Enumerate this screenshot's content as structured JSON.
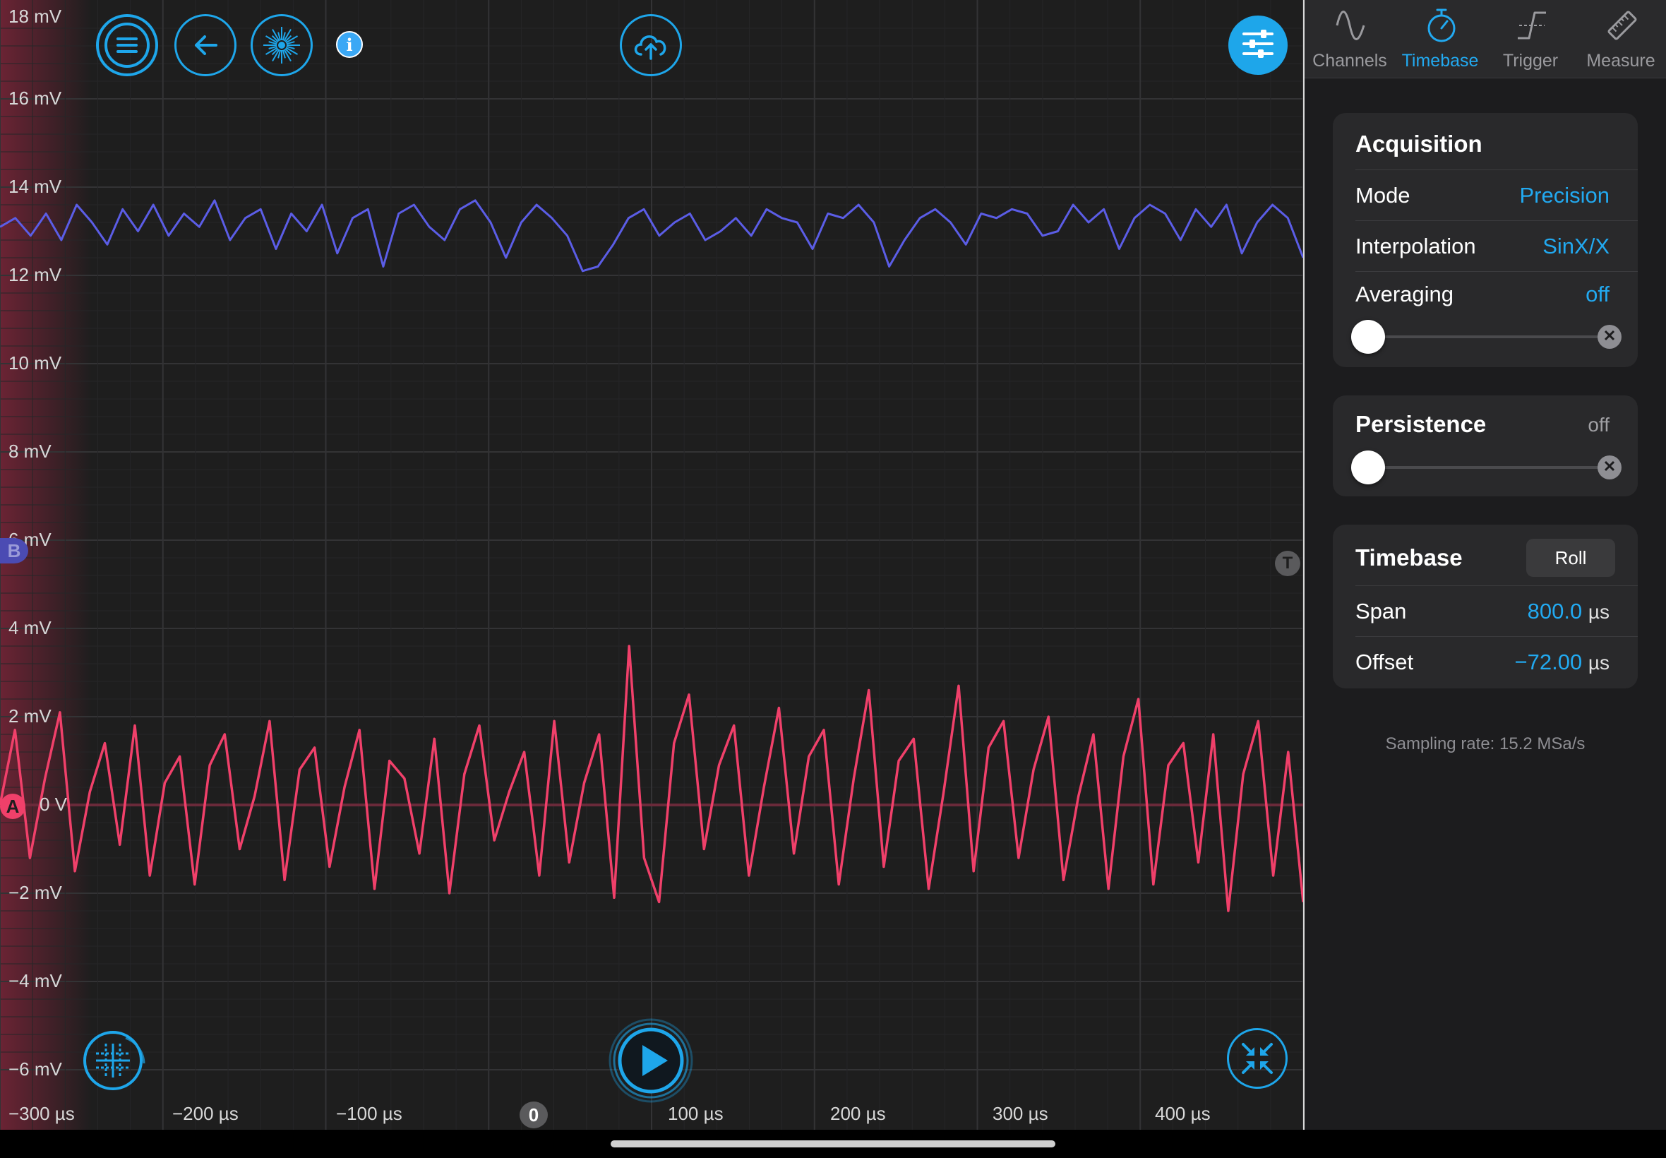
{
  "chart_data": {
    "type": "line",
    "y_axis": {
      "ticks": [
        "18 mV",
        "16 mV",
        "14 mV",
        "12 mV",
        "10 mV",
        "8 mV",
        "6 mV",
        "4 mV",
        "2 mV",
        "0 V",
        "−2 mV",
        "−4 mV",
        "−6 mV"
      ],
      "range_mV": [
        -6,
        18
      ]
    },
    "x_axis": {
      "ticks": [
        "−300 µs",
        "−200 µs",
        "−100 µs",
        "100 µs",
        "200 µs",
        "300 µs",
        "400 µs"
      ],
      "range_us": [
        -300,
        500
      ]
    },
    "grid": true,
    "series": [
      {
        "name": "B",
        "color": "#5b5de6",
        "values_mV": [
          13.1,
          13.3,
          12.9,
          13.4,
          12.8,
          13.6,
          13.2,
          12.7,
          13.5,
          13.0,
          13.6,
          12.9,
          13.4,
          13.1,
          13.7,
          12.8,
          13.3,
          13.5,
          12.6,
          13.4,
          13.0,
          13.6,
          12.5,
          13.3,
          13.5,
          12.2,
          13.4,
          13.6,
          13.1,
          12.8,
          13.5,
          13.7,
          13.2,
          12.4,
          13.2,
          13.6,
          13.3,
          12.9,
          12.1,
          12.2,
          12.7,
          13.3,
          13.5,
          12.9,
          13.2,
          13.4,
          12.8,
          13.0,
          13.3,
          12.9,
          13.5,
          13.3,
          13.2,
          12.6,
          13.4,
          13.3,
          13.6,
          13.2,
          12.2,
          12.8,
          13.3,
          13.5,
          13.2,
          12.7,
          13.4,
          13.3,
          13.5,
          13.4,
          12.9,
          13.0,
          13.6,
          13.2,
          13.5,
          12.6,
          13.3,
          13.6,
          13.4,
          12.8,
          13.5,
          13.1,
          13.6,
          12.5,
          13.2,
          13.6,
          13.3,
          12.4
        ]
      },
      {
        "name": "A",
        "color": "#f0406a",
        "values_mV": [
          0.0,
          1.7,
          -1.2,
          0.6,
          2.1,
          -1.5,
          0.3,
          1.4,
          -0.9,
          1.8,
          -1.6,
          0.5,
          1.1,
          -1.8,
          0.9,
          1.6,
          -1.0,
          0.2,
          1.9,
          -1.7,
          0.8,
          1.3,
          -1.4,
          0.4,
          1.7,
          -1.9,
          1.0,
          0.6,
          -1.1,
          1.5,
          -2.0,
          0.7,
          1.8,
          -0.8,
          0.3,
          1.2,
          -1.6,
          1.9,
          -1.3,
          0.5,
          1.6,
          -2.1,
          3.6,
          -1.2,
          -2.2,
          1.4,
          2.5,
          -1.0,
          0.9,
          1.8,
          -1.6,
          0.4,
          2.2,
          -1.1,
          1.1,
          1.7,
          -1.8,
          0.6,
          2.6,
          -1.4,
          1.0,
          1.5,
          -1.9,
          0.3,
          2.7,
          -1.5,
          1.3,
          1.9,
          -1.2,
          0.8,
          2.0,
          -1.7,
          0.2,
          1.6,
          -1.9,
          1.1,
          2.4,
          -1.8,
          0.9,
          1.4,
          -1.3,
          1.6,
          -2.4,
          0.7,
          1.9,
          -1.6,
          1.2,
          -2.2
        ]
      }
    ]
  },
  "channel_markers": {
    "a": "A",
    "b": "B",
    "trigger": "T",
    "zero_time": "0"
  },
  "toolbar": {
    "menu_icon": "hamburger-menu-icon",
    "back_icon": "arrow-left-icon",
    "display_icon": "starburst-icon",
    "info_icon": "info-icon",
    "upload_icon": "cloud-upload-icon",
    "settings_icon": "sliders-icon",
    "grid_icon": "grid-crosshair-icon",
    "play_icon": "play-icon",
    "compress_icon": "compress-arrows-icon"
  },
  "tabs": [
    {
      "label": "Channels",
      "icon": "sine-wave-icon",
      "active": false
    },
    {
      "label": "Timebase",
      "icon": "stopwatch-icon",
      "active": true
    },
    {
      "label": "Trigger",
      "icon": "trigger-edge-icon",
      "active": false
    },
    {
      "label": "Measure",
      "icon": "ruler-icon",
      "active": false
    }
  ],
  "acquisition": {
    "title": "Acquisition",
    "mode_label": "Mode",
    "mode_value": "Precision",
    "interpolation_label": "Interpolation",
    "interpolation_value": "SinX/X",
    "averaging_label": "Averaging",
    "averaging_value": "off",
    "averaging_level": 0
  },
  "persistence": {
    "title": "Persistence",
    "value": "off",
    "level": 0
  },
  "timebase": {
    "title": "Timebase",
    "roll_label": "Roll",
    "span_label": "Span",
    "span_value": "800.0",
    "span_unit": "µs",
    "offset_label": "Offset",
    "offset_value": "−72.00",
    "offset_unit": "µs"
  },
  "sampling_rate": "Sampling rate: 15.2 MSa/s",
  "colors": {
    "accent": "#1ea6ea",
    "channel_a": "#f0406a",
    "channel_b": "#5b5de6",
    "background": "#1e1e1e",
    "panel": "#1c1c1e"
  }
}
